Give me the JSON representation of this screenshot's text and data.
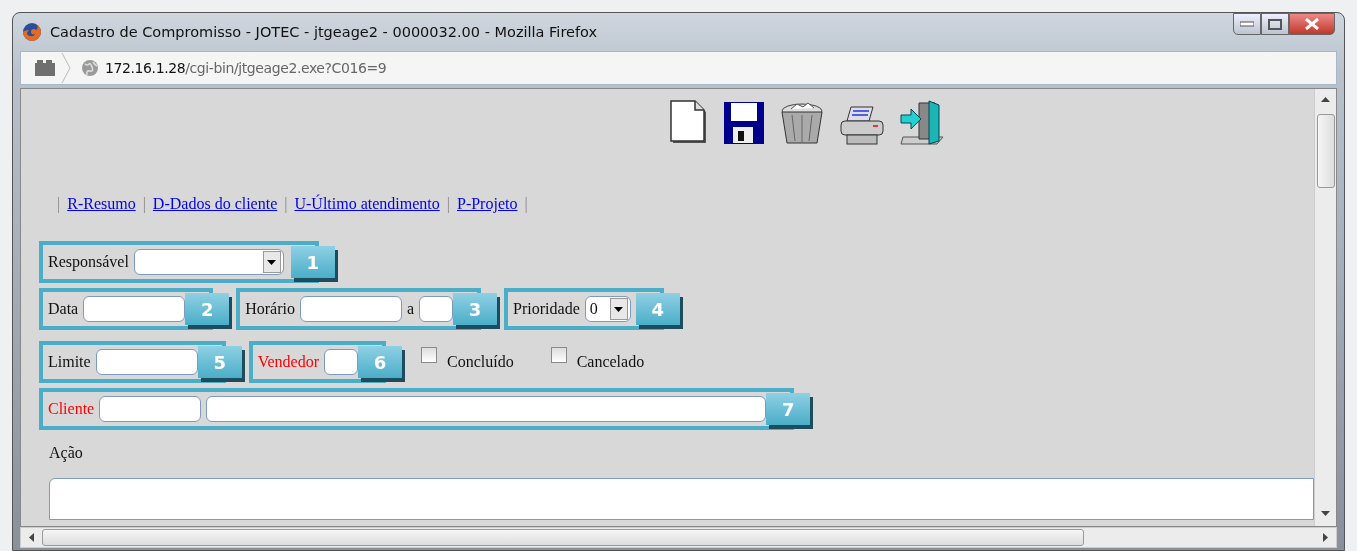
{
  "window": {
    "title": "Cadastro de Compromisso - JOTEC - jtgeage2 - 0000032.00 - Mozilla Firefox"
  },
  "address_bar": {
    "host": "172.16.1.28",
    "path": "/cgi-bin/jtgeage2.exe?C016=9"
  },
  "nav": [
    {
      "kind": "separator",
      "text": "|"
    },
    {
      "kind": "link",
      "text": "R-Resumo"
    },
    {
      "kind": "separator",
      "text": "|"
    },
    {
      "kind": "link",
      "text": "D-Dados do cliente"
    },
    {
      "kind": "separator",
      "text": "|"
    },
    {
      "kind": "link",
      "text": "U-Último atendimento"
    },
    {
      "kind": "separator",
      "text": "|"
    },
    {
      "kind": "link",
      "text": "P-Projeto"
    },
    {
      "kind": "separator",
      "text": "|"
    }
  ],
  "form_rows": [
    [
      {
        "kind": "group",
        "badge": "1",
        "items": [
          {
            "kind": "label",
            "text": "Responsável",
            "required": false
          },
          {
            "kind": "select-wide"
          }
        ]
      }
    ],
    [
      {
        "kind": "group",
        "badge": "2",
        "items": [
          {
            "kind": "label",
            "text": "Data",
            "required": false
          },
          {
            "kind": "input"
          }
        ]
      },
      {
        "kind": "group",
        "badge": "3",
        "items": [
          {
            "kind": "label",
            "text": "Horário",
            "required": false
          },
          {
            "kind": "input"
          },
          {
            "kind": "label",
            "text": "a",
            "required": false
          },
          {
            "kind": "input-short"
          }
        ]
      },
      {
        "kind": "group",
        "badge": "4",
        "items": [
          {
            "kind": "label",
            "text": "Prioridade",
            "required": false
          },
          {
            "kind": "select",
            "value": "0"
          }
        ]
      }
    ],
    [
      {
        "kind": "group",
        "badge": "5",
        "items": [
          {
            "kind": "label",
            "text": "Limite",
            "required": false
          },
          {
            "kind": "input"
          }
        ]
      },
      {
        "kind": "group",
        "badge": "6",
        "items": [
          {
            "kind": "label",
            "text": "Vendedor",
            "required": true
          },
          {
            "kind": "input-short"
          }
        ]
      },
      {
        "kind": "checkbox",
        "label": "Concluído",
        "checked": false
      },
      {
        "kind": "checkbox",
        "label": "Cancelado",
        "checked": false
      }
    ],
    [
      {
        "kind": "group",
        "badge": "7",
        "items": [
          {
            "kind": "label",
            "text": "Cliente",
            "required": true
          },
          {
            "kind": "input"
          },
          {
            "kind": "input-long"
          }
        ]
      }
    ]
  ],
  "action": {
    "label": "Ação"
  }
}
